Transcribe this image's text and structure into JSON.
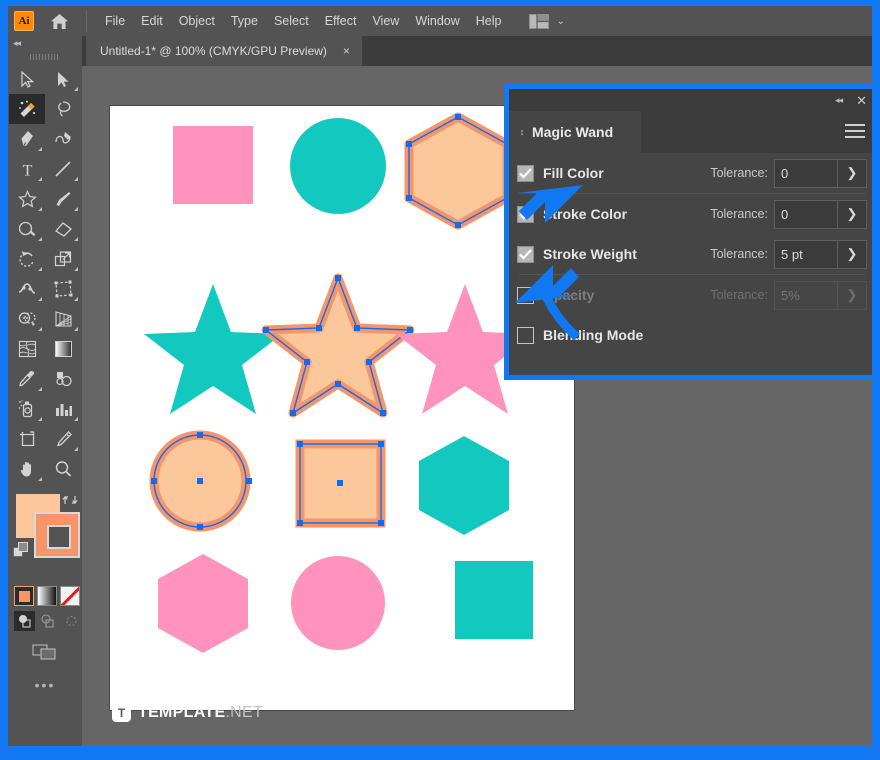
{
  "app": {
    "name": "Adobe Illustrator",
    "logo_text": "Ai",
    "home_icon": "home-icon",
    "workspace_icon": "workspace-layout-icon",
    "workspace_chevron": "⌄"
  },
  "menubar": {
    "items": [
      {
        "label": "File"
      },
      {
        "label": "Edit"
      },
      {
        "label": "Object"
      },
      {
        "label": "Type"
      },
      {
        "label": "Select"
      },
      {
        "label": "Effect"
      },
      {
        "label": "View"
      },
      {
        "label": "Window"
      },
      {
        "label": "Help"
      }
    ]
  },
  "tabbar": {
    "document_tab": {
      "title": "Untitled-1* @ 100% (CMYK/GPU Preview)",
      "close_label": "×"
    }
  },
  "toolbar": {
    "collapse_label": "◂◂",
    "tools": [
      {
        "name": "selection-tool",
        "has_corner": false
      },
      {
        "name": "direct-selection-tool",
        "has_corner": true
      },
      {
        "name": "magic-wand-tool",
        "has_corner": false,
        "active": true
      },
      {
        "name": "lasso-tool",
        "has_corner": false
      },
      {
        "name": "pen-tool",
        "has_corner": true
      },
      {
        "name": "curvature-tool",
        "has_corner": false
      },
      {
        "name": "type-tool",
        "has_corner": true
      },
      {
        "name": "line-segment-tool",
        "has_corner": true
      },
      {
        "name": "shape-star-tool",
        "has_corner": true
      },
      {
        "name": "paintbrush-tool",
        "has_corner": true
      },
      {
        "name": "shaper-tool",
        "has_corner": true
      },
      {
        "name": "eraser-tool",
        "has_corner": true
      },
      {
        "name": "rotate-tool",
        "has_corner": true
      },
      {
        "name": "scale-tool",
        "has_corner": true
      },
      {
        "name": "width-tool",
        "has_corner": true
      },
      {
        "name": "free-transform-tool",
        "has_corner": true
      },
      {
        "name": "shape-builder-tool",
        "has_corner": true
      },
      {
        "name": "perspective-grid-tool",
        "has_corner": true
      },
      {
        "name": "mesh-tool",
        "has_corner": false
      },
      {
        "name": "gradient-tool",
        "has_corner": false
      },
      {
        "name": "eyedropper-tool",
        "has_corner": true
      },
      {
        "name": "blend-tool",
        "has_corner": false
      },
      {
        "name": "symbol-sprayer-tool",
        "has_corner": true
      },
      {
        "name": "column-graph-tool",
        "has_corner": true
      },
      {
        "name": "artboard-tool",
        "has_corner": false
      },
      {
        "name": "slice-tool",
        "has_corner": true
      },
      {
        "name": "hand-tool",
        "has_corner": true
      },
      {
        "name": "zoom-tool",
        "has_corner": false
      }
    ],
    "fill_color": "#fcc79a",
    "stroke_color": "#f79468",
    "swap_icon": "swap-fill-stroke-icon",
    "default_icon": "default-fill-stroke-icon",
    "paint_modes": [
      {
        "name": "color-swatch-button",
        "selected": true
      },
      {
        "name": "gradient-swatch-button",
        "selected": false
      },
      {
        "name": "none-swatch-button",
        "selected": false
      }
    ],
    "draw_modes": [
      {
        "name": "draw-normal-button",
        "selected": true
      },
      {
        "name": "draw-behind-button",
        "selected": false
      },
      {
        "name": "draw-inside-button",
        "selected": false
      }
    ],
    "screen_mode_icon": "change-screen-mode-icon",
    "more_tools_label": "•••"
  },
  "panel": {
    "title": "Magic Wand",
    "collapse_label": "◂◂",
    "close_label": "✕",
    "menu_icon": "panel-menu-icon",
    "tab_arrows": "↕",
    "rows": [
      {
        "name": "fill-color",
        "label": "Fill Color",
        "checked": true,
        "enabled": true,
        "tolerance_label": "Tolerance:",
        "tolerance_value": "0",
        "stepper_icon": "chevron-right-icon"
      },
      {
        "name": "stroke-color",
        "label": "Stroke Color",
        "checked": true,
        "enabled": true,
        "tolerance_label": "Tolerance:",
        "tolerance_value": "0",
        "stepper_icon": "chevron-right-icon"
      },
      {
        "name": "stroke-weight",
        "label": "Stroke Weight",
        "checked": true,
        "enabled": true,
        "tolerance_label": "Tolerance:",
        "tolerance_value": "5 pt",
        "stepper_icon": "chevron-right-icon"
      },
      {
        "name": "opacity",
        "label": "Opacity",
        "checked": false,
        "enabled": false,
        "tolerance_label": "Tolerance:",
        "tolerance_value": "5%",
        "stepper_icon": "chevron-right-icon"
      },
      {
        "name": "blending-mode",
        "label": "Blending Mode",
        "checked": false,
        "enabled": false,
        "tolerance_label": "",
        "tolerance_value": "",
        "stepper_icon": ""
      }
    ]
  },
  "canvas": {
    "colors": {
      "pink": "#ff93be",
      "teal": "#13c9bf",
      "selected_fill": "#fcc79a",
      "selected_stroke": "#f79468",
      "anchor": "#0d6ef5",
      "artboard": "#ffffff"
    },
    "shapes": [
      {
        "name": "square-pink",
        "type": "square",
        "row": 1,
        "col": 1,
        "color": "pink",
        "selected": false
      },
      {
        "name": "circle-teal",
        "type": "circle",
        "row": 1,
        "col": 2,
        "color": "teal",
        "selected": false
      },
      {
        "name": "hexagon-peach",
        "type": "hexagon",
        "row": 1,
        "col": 3,
        "color": "selected",
        "selected": true
      },
      {
        "name": "star-teal",
        "type": "star",
        "row": 2,
        "col": 1,
        "color": "teal",
        "selected": false
      },
      {
        "name": "star-peach",
        "type": "star",
        "row": 2,
        "col": 2,
        "color": "selected",
        "selected": true
      },
      {
        "name": "star-pink",
        "type": "star",
        "row": 2,
        "col": 3,
        "color": "pink",
        "selected": false
      },
      {
        "name": "circle-peach",
        "type": "circle",
        "row": 3,
        "col": 1,
        "color": "selected",
        "selected": true
      },
      {
        "name": "square-peach",
        "type": "square",
        "row": 3,
        "col": 2,
        "color": "selected",
        "selected": true
      },
      {
        "name": "hexagon-teal",
        "type": "hexagon",
        "row": 3,
        "col": 3,
        "color": "teal",
        "selected": false
      },
      {
        "name": "hexagon-pink",
        "type": "hexagon",
        "row": 4,
        "col": 1,
        "color": "pink",
        "selected": false
      },
      {
        "name": "circle-pink",
        "type": "circle",
        "row": 4,
        "col": 2,
        "color": "pink",
        "selected": false
      },
      {
        "name": "square-teal",
        "type": "square",
        "row": 4,
        "col": 3,
        "color": "teal",
        "selected": false
      }
    ]
  },
  "annotations": {
    "arrow_color": "#1177f2",
    "arrows": [
      {
        "name": "arrow-to-stroke-color-checkbox"
      },
      {
        "name": "arrow-to-stroke-weight-checkbox"
      }
    ],
    "highlight_color": "#1177f2"
  },
  "watermark": {
    "badge": "T",
    "name": "TEMPLATE",
    "tld": ".NET"
  }
}
